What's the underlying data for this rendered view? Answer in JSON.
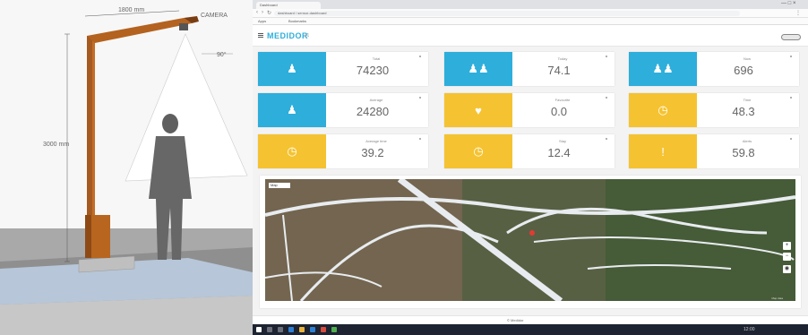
{
  "render": {
    "dim_top": "1800 mm",
    "dim_side": "3000 mm",
    "dim_cam": "CAMERA",
    "dim_angle": "90°"
  },
  "browser": {
    "tab_title": "Dashboard",
    "address": "dashboard / sensor-dashboard",
    "bookmarks": [
      "Apps",
      "Bookmarks"
    ],
    "win_controls": "— □ ×"
  },
  "app": {
    "logo": "MEDIDOR",
    "logo_sub": "v1"
  },
  "colors": {
    "blue": "#2eaedb",
    "yellow": "#f5c331",
    "dark": "#1d2331"
  },
  "cards": [
    {
      "label": "Total",
      "value": "74230",
      "icon": "person-icon",
      "color": "blue"
    },
    {
      "label": "Today",
      "value": "74.1",
      "icon": "group-icon",
      "color": "blue"
    },
    {
      "label": "Now",
      "value": "696",
      "icon": "group-icon",
      "color": "blue"
    },
    {
      "label": "Average",
      "value": "24280",
      "icon": "person-icon",
      "color": "blue"
    },
    {
      "label": "Favourite",
      "value": "0.0",
      "icon": "heart-icon",
      "color": "yellow"
    },
    {
      "label": "Time",
      "value": "48.3",
      "icon": "clock-icon",
      "color": "yellow"
    },
    {
      "label": "Average time",
      "value": "39.2",
      "icon": "clock-icon",
      "color": "yellow"
    },
    {
      "label": "Stay",
      "value": "12.4",
      "icon": "clock-icon",
      "color": "yellow"
    },
    {
      "label": "Alerts",
      "value": "59.8",
      "icon": "alert-icon",
      "color": "yellow"
    }
  ],
  "map": {
    "badge": "Map",
    "attribution": "Map data",
    "zoom_in": "+",
    "zoom_out": "−"
  },
  "footer": {
    "text": "© Medidor"
  },
  "taskbar": {
    "tray": "12:00"
  }
}
